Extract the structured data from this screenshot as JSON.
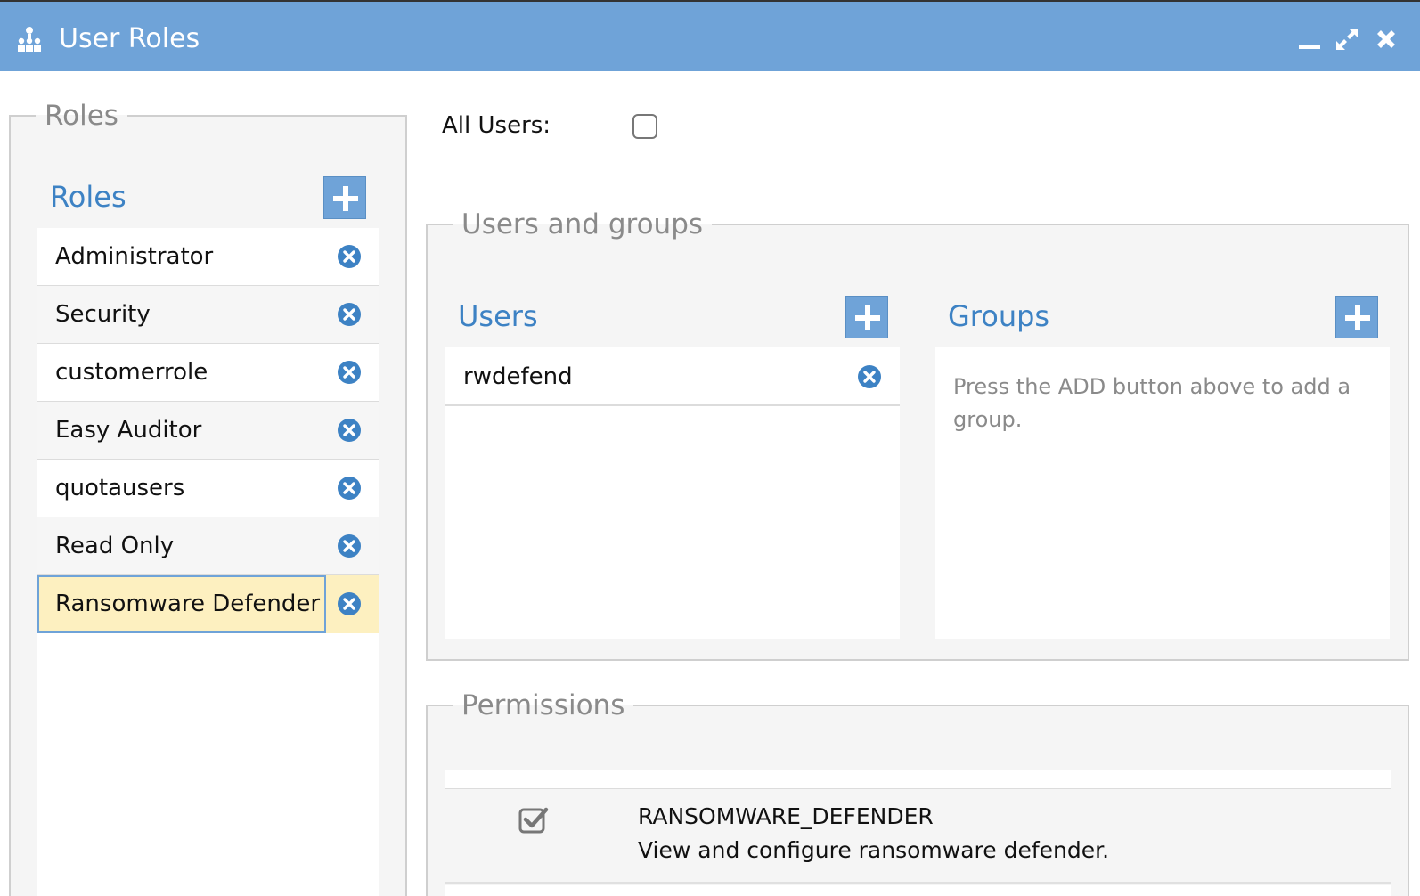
{
  "window": {
    "title": "User Roles",
    "icon": "hierarchy-icon",
    "controls": [
      "minimize-icon",
      "maximize-icon",
      "close-icon"
    ],
    "accent_color": "#6fa3d8"
  },
  "roles_section": {
    "legend": "Roles",
    "panel_title": "Roles",
    "add_icon": "plus-icon",
    "remove_icon": "remove-circle-icon",
    "items": [
      {
        "label": "Administrator",
        "selected": false
      },
      {
        "label": "Security",
        "selected": false
      },
      {
        "label": "customerrole",
        "selected": false
      },
      {
        "label": "Easy Auditor",
        "selected": false
      },
      {
        "label": "quotausers",
        "selected": false
      },
      {
        "label": "Read Only",
        "selected": false
      },
      {
        "label": "Ransomware Defender",
        "selected": true
      }
    ]
  },
  "all_users": {
    "label": "All Users:",
    "checked": false
  },
  "users_and_groups": {
    "legend": "Users and groups",
    "users": {
      "title": "Users",
      "items": [
        "rwdefend"
      ]
    },
    "groups": {
      "title": "Groups",
      "empty_message": "Press the ADD button above to add a group."
    }
  },
  "permissions": {
    "legend": "Permissions",
    "items": [
      {
        "name": "RANSOMWARE_DEFENDER",
        "description": "View and configure ransomware defender.",
        "checked": true
      }
    ]
  }
}
